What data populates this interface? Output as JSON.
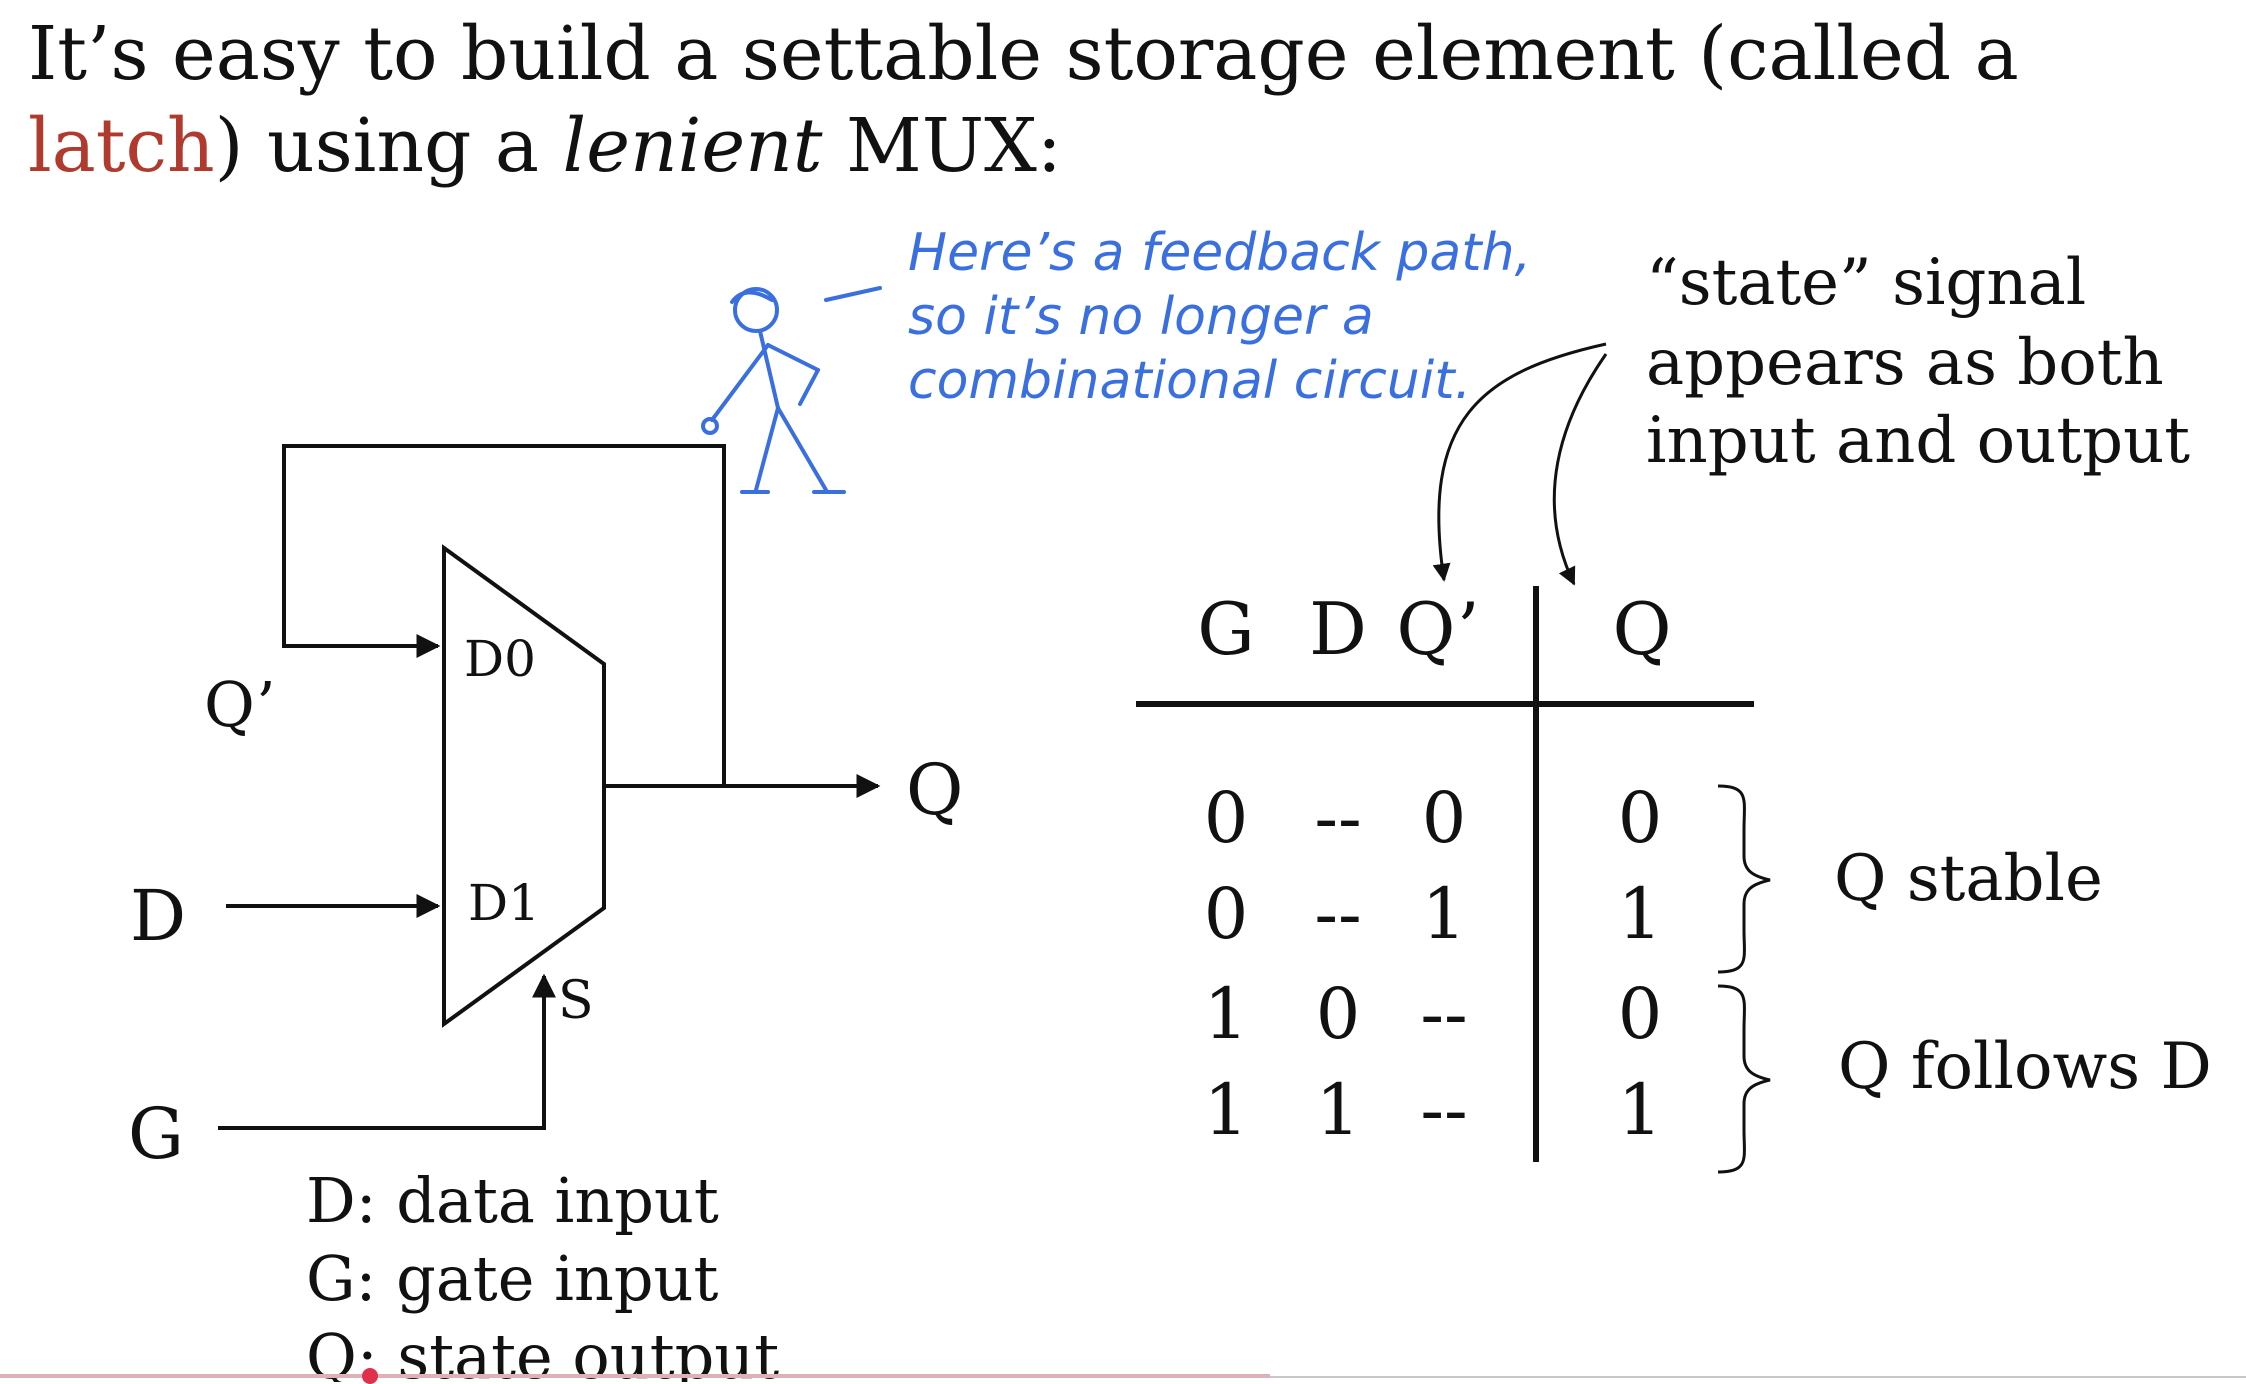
{
  "title": {
    "line1": "It’s easy to build a settable storage element (called a",
    "line2_highlight": "latch",
    "line2_a": ") using a ",
    "line2_em": "lenient",
    "line2_b": " MUX:"
  },
  "colors": {
    "highlight": "#b03a2e",
    "handwriting": "#3a6fe0",
    "ink": "#111111"
  },
  "note": {
    "line1": "Here’s a feedback path,",
    "line2": "so it’s no longer a",
    "line3": "combinational circuit."
  },
  "state_note": {
    "line1": "“state” signal",
    "line2": "appears as both",
    "line3": "input and output"
  },
  "circuit": {
    "q_prime": "Q’",
    "d": "D",
    "g": "G",
    "q": "Q",
    "d0": "D0",
    "d1": "D1",
    "s": "S"
  },
  "legend": {
    "d": "D: data input",
    "g": "G: gate input",
    "q": "Q: state output"
  },
  "truth_table": {
    "headers": {
      "g": "G",
      "d": "D",
      "qp": "Q’",
      "q": "Q"
    },
    "rows": [
      {
        "g": "0",
        "d": "--",
        "qp": "0",
        "q": "0"
      },
      {
        "g": "0",
        "d": "--",
        "qp": "1",
        "q": "1"
      },
      {
        "g": "1",
        "d": "0",
        "qp": "--",
        "q": "0"
      },
      {
        "g": "1",
        "d": "1",
        "qp": "--",
        "q": "1"
      }
    ],
    "group1": "Q stable",
    "group2": "Q follows D"
  }
}
